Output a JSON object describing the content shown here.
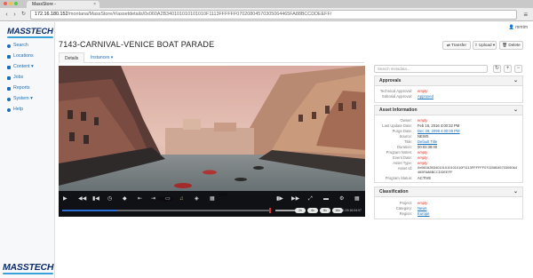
{
  "browser": {
    "tab_title": "MassStore -",
    "url_host": "172.16.180.152",
    "url_path": "/montana/MassStore/#/assetdetails/0x060A2B340101010101010F1113FFFFFF07020804570305064465FA88BCCDDEEFF/"
  },
  "app": {
    "brand": "MASSTECH",
    "user": "mmtm"
  },
  "sidebar": {
    "items": [
      {
        "label": "Search",
        "icon": "search-icon"
      },
      {
        "label": "Locations",
        "icon": "folder-icon"
      },
      {
        "label": "Content ▾",
        "icon": "content-icon"
      },
      {
        "label": "Jobs",
        "icon": "jobs-icon"
      },
      {
        "label": "Reports",
        "icon": "reports-icon"
      },
      {
        "label": "System ▾",
        "icon": "system-icon"
      },
      {
        "label": "Help",
        "icon": "help-icon"
      }
    ]
  },
  "asset": {
    "title": "7143-CARNIVAL-VENICE BOAT PARADE"
  },
  "actions": {
    "transfer": "Transfer",
    "upload": "Upload ▾",
    "delete": "Delete"
  },
  "tabs": {
    "details": "Details",
    "instances": "Instances ▾"
  },
  "player": {
    "timecode": "1:09:16:04:07",
    "progress_fraction": 0.26,
    "speeds": [
      "2x",
      "4x",
      "8x",
      "16x"
    ]
  },
  "right_panel": {
    "search_placeholder": "Search metadata...",
    "approvals": {
      "header": "Approvals",
      "rows": [
        {
          "key": "Technical Approval:",
          "value": "empty"
        },
        {
          "key": "Editorial Approval:",
          "value": "Approved"
        }
      ]
    },
    "asset_info": {
      "header": "Asset Information",
      "rows": [
        {
          "key": "Owner:",
          "value": "empty"
        },
        {
          "key": "Last Update Date:",
          "value": "Feb 16, 2016 4:00:32 PM"
        },
        {
          "key": "Purge Date:",
          "value": "Dec 29, 2099 4:00:00 PM"
        },
        {
          "key": "Source:",
          "value": "NEWS"
        },
        {
          "key": "Title:",
          "value": "Default Title"
        },
        {
          "key": "Duration:",
          "value": "00:03:38:00"
        },
        {
          "key": "Program Notes:",
          "value": "empty"
        },
        {
          "key": "Event Date:",
          "value": "empty"
        },
        {
          "key": "Asset Type:",
          "value": "empty"
        },
        {
          "key": "Asset Id:",
          "value": "0x060A2B340101010101010F1113FFFFFF07020804570305064465FA88BCCDDEEFF"
        },
        {
          "key": "Program Status:",
          "value": "ACTIVE"
        }
      ]
    },
    "classification": {
      "header": "Classification",
      "rows": [
        {
          "key": "Project:",
          "value": "empty"
        },
        {
          "key": "Category:",
          "value": "News"
        },
        {
          "key": "Region:",
          "value": "Europe"
        }
      ]
    }
  },
  "colors": {
    "accent": "#1b6fb8",
    "brand": "#0d2d6b",
    "empty_value": "#d32f2f"
  }
}
